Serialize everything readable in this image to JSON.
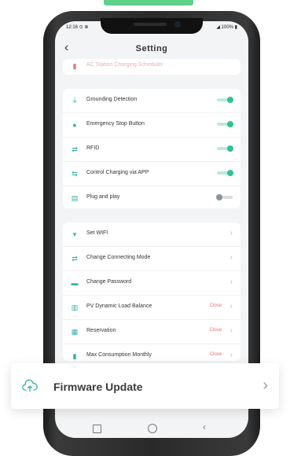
{
  "status_bar": {
    "time": "12:16 ⊙ ⊗",
    "system": "◢ 100% ▮"
  },
  "header": {
    "title": "Setting",
    "back_icon": "‹"
  },
  "group0": {
    "items": [
      {
        "label": "AC Station Charging Scheduler",
        "icon": "charger-icon",
        "color": "#e07a7a"
      }
    ]
  },
  "group1": {
    "items": [
      {
        "label": "Grounding Detection",
        "icon": "ground-icon",
        "glyph": "⏚",
        "toggle": "on"
      },
      {
        "label": "Emergency Stop Button",
        "icon": "stop-icon",
        "glyph": "●",
        "toggle": "on"
      },
      {
        "label": "RFID",
        "icon": "rfid-icon",
        "glyph": "⇄",
        "toggle": "on"
      },
      {
        "label": "Control Charging via APP",
        "icon": "app-icon",
        "glyph": "⇆",
        "toggle": "on"
      },
      {
        "label": "Plug and play",
        "icon": "plug-icon",
        "glyph": "▤",
        "toggle": "off"
      }
    ]
  },
  "group2": {
    "items": [
      {
        "label": "Set WIFI",
        "icon": "wifi-icon",
        "glyph": "▾",
        "status": ""
      },
      {
        "label": "Change Connecting Mode",
        "icon": "connect-icon",
        "glyph": "⇄",
        "status": ""
      },
      {
        "label": "Change Password",
        "icon": "lock-icon",
        "glyph": "▬",
        "status": ""
      },
      {
        "label": "PV Dynamic Load Balance",
        "icon": "pv-icon",
        "glyph": "▥",
        "status": "Close"
      },
      {
        "label": "Reservation",
        "icon": "calendar-icon",
        "glyph": "▦",
        "status": "Close"
      },
      {
        "label": "Max Consumption Monthly",
        "icon": "meter-icon",
        "glyph": "▮",
        "status": "Close"
      }
    ]
  },
  "banner": {
    "label": "Firmware Update",
    "icon": "cloud-upload-icon",
    "chevron": "›"
  },
  "navbar": {
    "back": "‹"
  },
  "colors": {
    "accent": "#2cc38f",
    "icon": "#2fb3a7",
    "close": "#ef6b6b",
    "top_accent": "#5fd08a"
  }
}
